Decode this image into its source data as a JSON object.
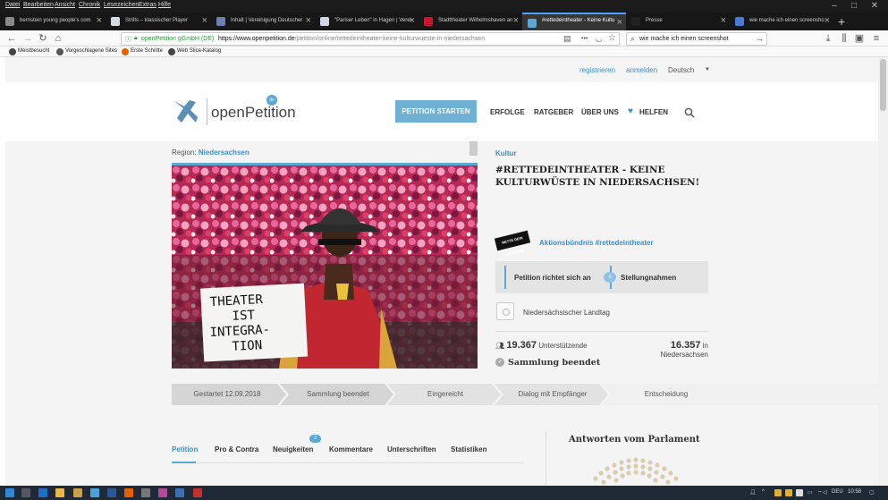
{
  "menubar": {
    "items": [
      "Datei",
      "Bearbeiten",
      "Ansicht",
      "Chronik",
      "Lesezeichen",
      "Extras",
      "Hilfe"
    ]
  },
  "tabs": [
    {
      "title": "bernstein young people's com",
      "color": "#8a8a8a"
    },
    {
      "title": "Strilts – klassischer Player",
      "color": "#d7dbe0"
    },
    {
      "title": "Inhalt | Vereinigung Deutscher",
      "color": "#6b7fb0"
    },
    {
      "title": "\"Pariser Leben\" in Hagen | Verei",
      "color": "#d0d6e8"
    },
    {
      "title": "Stadttheater Wilhelmshaven an",
      "color": "#c8142c"
    },
    {
      "title": "#rettedeintheater - Keine Kultu",
      "color": "#5aa8d6"
    },
    {
      "title": "Presse",
      "color": "#222222"
    },
    {
      "title": "wie mache ich einen screensho",
      "color": "#4a7bd6"
    }
  ],
  "navbar": {
    "site_identity": "openPetition gGmbH (DE)",
    "url_host": "https://www.openpetition.de",
    "url_path": "/petition/online/rettedeintheater-keine-kulturwueste-in-niedersachsen",
    "more": "•••",
    "search_value": "wie mache ich einen screenshot"
  },
  "bookmarks": [
    {
      "label": "Meistbesucht",
      "color": "#444"
    },
    {
      "label": "Vorgeschlagene Sites",
      "color": "#555"
    },
    {
      "label": "Erste Schritte",
      "color": "#e66000"
    },
    {
      "label": "Web Slice-Katalog",
      "color": "#444"
    }
  ],
  "site": {
    "top": {
      "register": "registrieren",
      "login": "anmelden",
      "language": "Deutsch"
    },
    "logo": {
      "text": "openPetition",
      "badge": "de"
    },
    "nav": {
      "start": "PETITION STARTEN",
      "successes": "ERFOLGE",
      "guide": "RATGEBER",
      "about": "ÜBER UNS",
      "help": "HELFEN"
    }
  },
  "petition": {
    "region_label": "Region:",
    "region": "Niedersachsen",
    "category": "Kultur",
    "title": "#RETTEDEINTHEATER - KEINE KULTURWÜSTE IN NIEDERSACHSEN!",
    "initiator_logo_text": "RETTE DEIN THEATER",
    "initiator": "Aktionsbündnis #rettedeintheater",
    "target_label": "Petition richtet sich an",
    "statements_label": "Stellungnahmen",
    "statements_count": "0",
    "recipient": "Niedersächsischer Landtag",
    "supporters_count": "19.367",
    "supporters_label": "Unterstützende",
    "region_count": "16.357",
    "region_count_label": "in Niedersachsen",
    "status": "Sammlung beendet",
    "sign_text": [
      "THEATER",
      "IST",
      "INTEGRA-",
      "TION"
    ]
  },
  "progress": [
    "Gestartet 12.09.2018",
    "Sammlung beendet",
    "Eingereicht",
    "Dialog mit Empfänger",
    "Entscheidung"
  ],
  "content_tabs": {
    "items": [
      "Petition",
      "Pro & Contra",
      "Neuigkeiten",
      "Kommentare",
      "Unterschriften",
      "Statistiken"
    ],
    "news_badge": "2",
    "active": "Petition"
  },
  "parliament": {
    "title": "Antworten vom Parlament"
  },
  "taskbar": {
    "language": "DEU",
    "time": "10:58"
  }
}
